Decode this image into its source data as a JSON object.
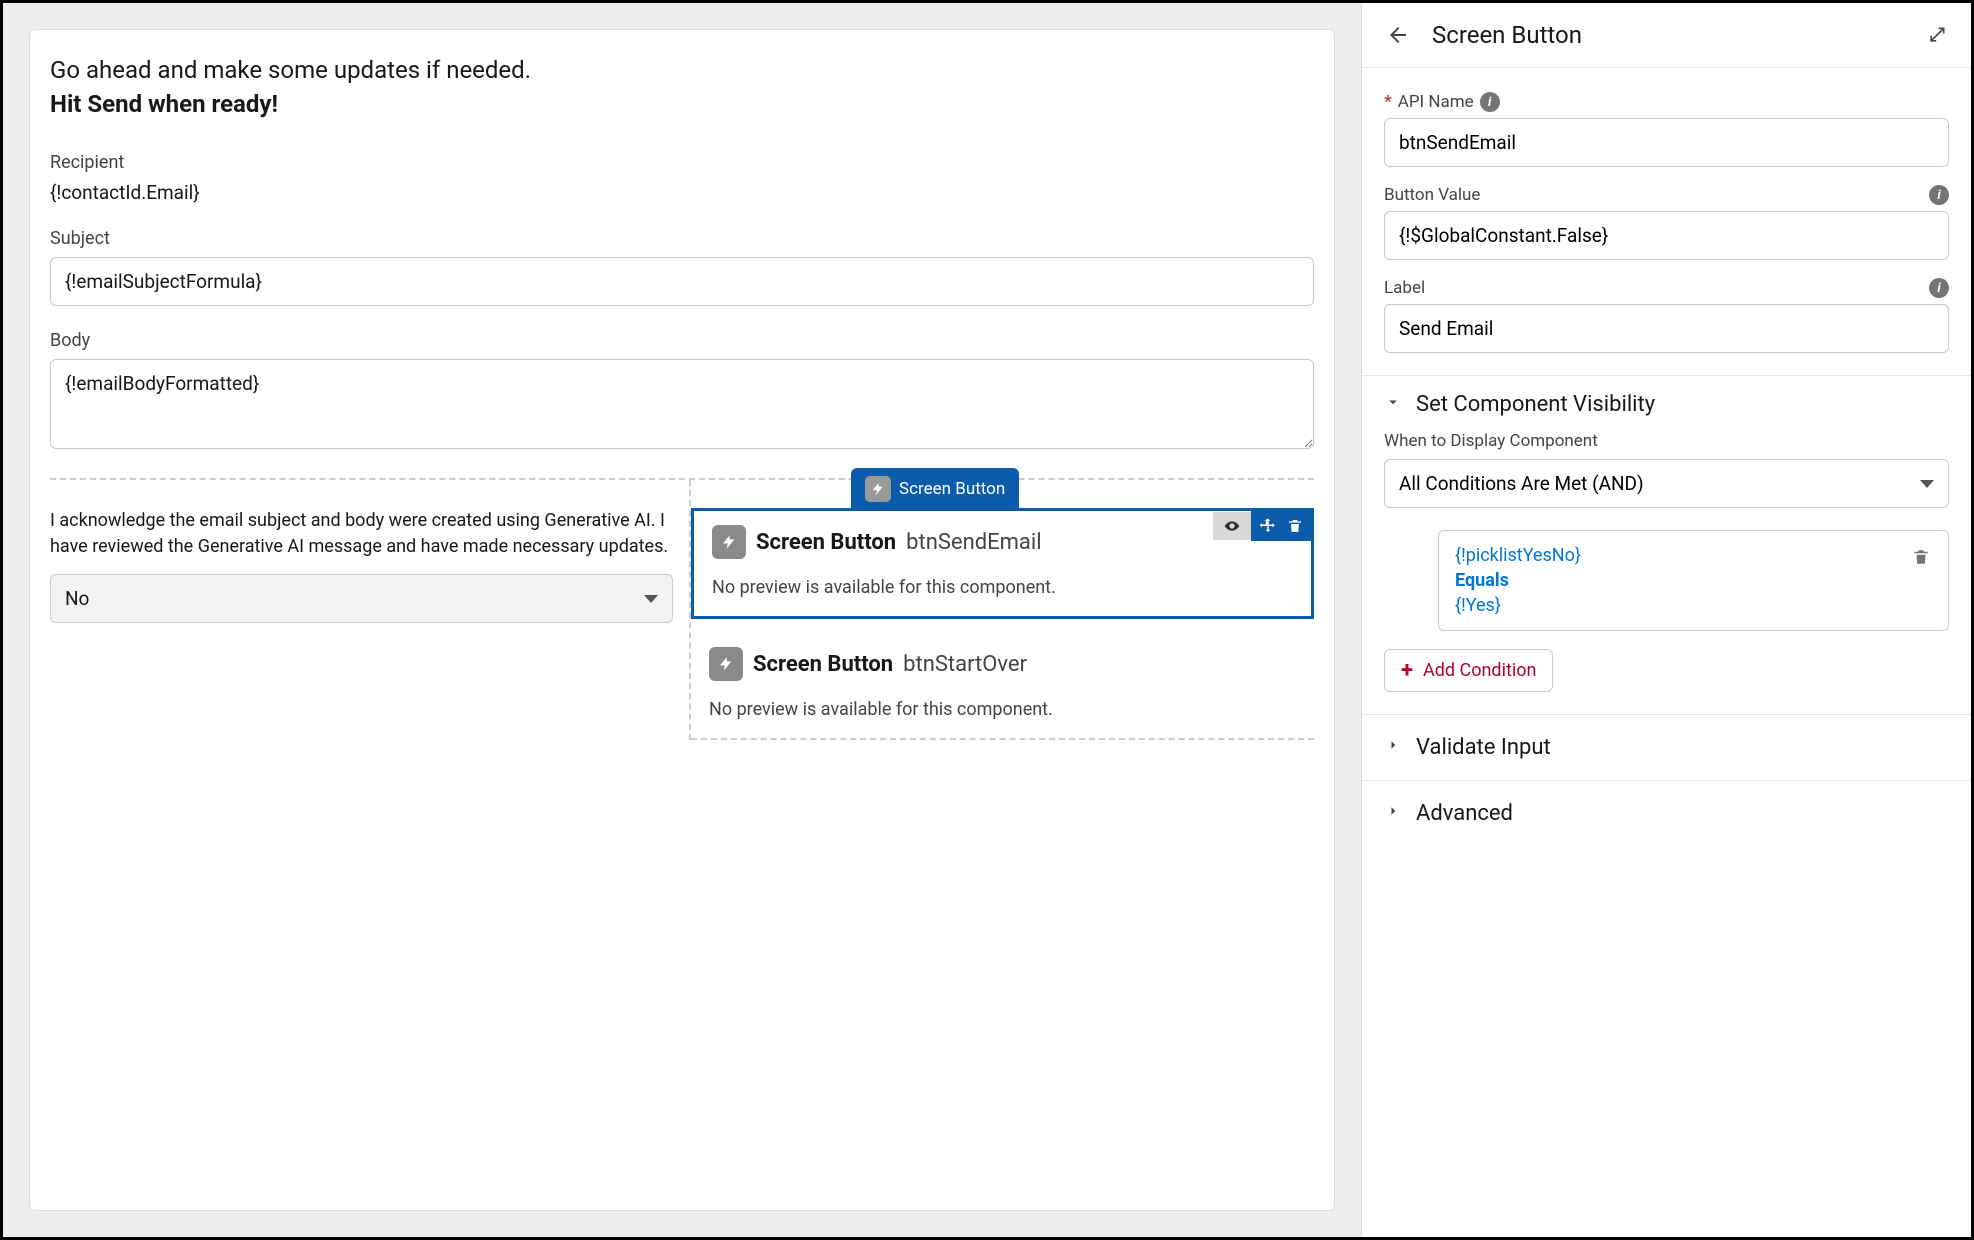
{
  "canvas": {
    "intro_line1": "Go ahead and make some updates if needed.",
    "intro_line2": "Hit Send when ready!",
    "recipient_label": "Recipient",
    "recipient_value": "{!contactId.Email}",
    "subject_label": "Subject",
    "subject_value": "{!emailSubjectFormula}",
    "body_label": "Body",
    "body_value": "{!emailBodyFormatted}",
    "ack_text": "I acknowledge the email subject and body were created using Generative AI. I have reviewed the Generative AI message and have made necessary updates.",
    "ack_select_value": "No",
    "component_tag": "Screen Button",
    "comp1": {
      "type_label": "Screen Button",
      "api_name": "btnSendEmail",
      "no_preview": "No preview is available for this component."
    },
    "comp2": {
      "type_label": "Screen Button",
      "api_name": "btnStartOver",
      "no_preview": "No preview is available for this component."
    }
  },
  "sidebar": {
    "title": "Screen Button",
    "api_name_label": "API Name",
    "api_name_value": "btnSendEmail",
    "button_value_label": "Button Value",
    "button_value_value": "{!$GlobalConstant.False}",
    "label_label": "Label",
    "label_value": "Send Email",
    "visibility_title": "Set Component Visibility",
    "when_label": "When to Display Component",
    "when_value": "All Conditions Are Met (AND)",
    "condition": {
      "resource": "{!picklistYesNo}",
      "operator": "Equals",
      "value": "{!Yes}"
    },
    "add_condition": "Add Condition",
    "validate_title": "Validate Input",
    "advanced_title": "Advanced"
  }
}
